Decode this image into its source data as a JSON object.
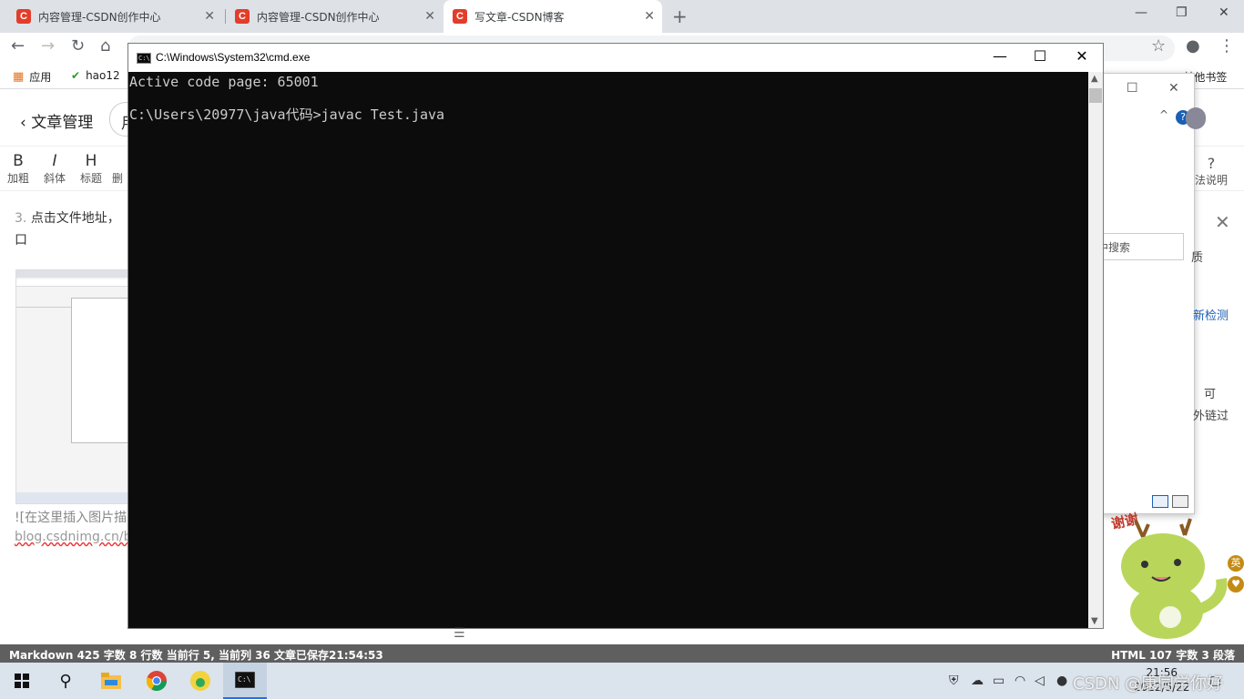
{
  "browser": {
    "tabs": [
      {
        "title": "内容管理-CSDN创作中心",
        "favicon": "C",
        "active": false
      },
      {
        "title": "内容管理-CSDN创作中心",
        "favicon": "C",
        "active": false
      },
      {
        "title": "写文章-CSDN博客",
        "favicon": "C",
        "active": true
      }
    ],
    "url": "",
    "bookmarks": {
      "apps": "应用",
      "hao": "hao12",
      "other": "其他书签"
    }
  },
  "editor": {
    "back_label": "文章管理",
    "title_stub": "用",
    "toolbar": [
      {
        "glyph": "B",
        "label": "加粗"
      },
      {
        "glyph": "I",
        "label": "斜体"
      },
      {
        "glyph": "H",
        "label": "标题"
      },
      {
        "glyph": "",
        "label": "删"
      }
    ],
    "help_label": "法说明",
    "step_num": "3.",
    "step_text": "点击文件地址，",
    "step_text2": "口",
    "img_md": "![在这里插入图片描",
    "img_url": "blog.csdnimg.cn/b"
  },
  "side_panel": {
    "search": "中搜索",
    "t1": "质",
    "t2": "新检测",
    "t3": "可",
    "t4": "外链过"
  },
  "cmd": {
    "title": "C:\\Windows\\System32\\cmd.exe",
    "lines": [
      "Active code page: 65001",
      "",
      "C:\\Users\\20977\\java代码>javac Test.java"
    ]
  },
  "status_bar": {
    "left": "Markdown  425 字数  8 行数  当前行 5, 当前列 36  文章已保存21:54:53",
    "right": "HTML  107 字数  3 段落"
  },
  "mascot_label": "谢谢",
  "badges": {
    "lang": "英"
  },
  "taskbar": {
    "time": "21:56",
    "date": "2022/5/22",
    "watermark": "CSDN @康同学你好"
  }
}
